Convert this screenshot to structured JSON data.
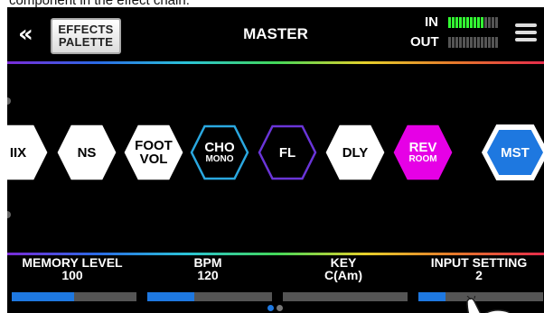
{
  "caption": "component in the effect chain.",
  "header": {
    "back_icon": "double-chevron-left-icon",
    "palette_line1": "EFFECTS",
    "palette_line2": "PALETTE",
    "title": "MASTER",
    "in_label": "IN",
    "out_label": "OUT",
    "in_level": 0.72,
    "out_level": 0,
    "menu_icon": "hamburger-menu-icon"
  },
  "chain": [
    {
      "line1": "IIX",
      "line2": "",
      "style": "white"
    },
    {
      "line1": "NS",
      "line2": "",
      "style": "white"
    },
    {
      "line1": "FOOT",
      "line2": "VOL",
      "style": "white-big"
    },
    {
      "line1": "CHO",
      "line2": "MONO",
      "style": "outline-cyan"
    },
    {
      "line1": "FL",
      "line2": "",
      "style": "outline-purple"
    },
    {
      "line1": "DLY",
      "line2": "",
      "style": "white"
    },
    {
      "line1": "REV",
      "line2": "ROOM",
      "style": "magenta"
    },
    {
      "line1": "MST",
      "line2": "",
      "style": "master"
    }
  ],
  "params": [
    {
      "name": "MEMORY LEVEL",
      "value": "100",
      "level": 0.5
    },
    {
      "name": "BPM",
      "value": "120",
      "level": 0.38
    },
    {
      "name": "KEY",
      "value": "C(Am)",
      "level": 0
    },
    {
      "name": "INPUT SETTING",
      "value": "2",
      "level": 0.22
    }
  ],
  "pager": {
    "count": 2,
    "current": 1
  },
  "colors": {
    "accent_blue": "#1e78e0",
    "magenta": "#e600e6",
    "meter_green": "#33ff33"
  }
}
